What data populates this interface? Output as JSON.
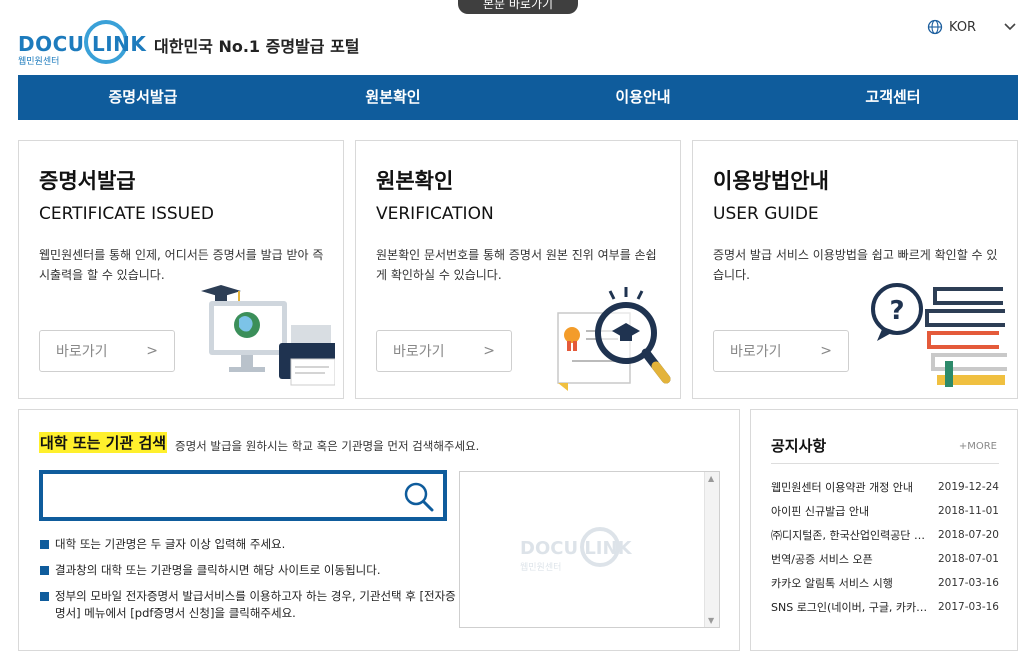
{
  "header": {
    "skip_link": "본문 바로가기",
    "logo_text": "DOCU LINK",
    "logo_sub": "웹민원센터",
    "tagline": "대한민국 No.1 증명발급 포털",
    "lang": "KOR"
  },
  "nav": [
    "증명서발급",
    "원본확인",
    "이용안내",
    "고객센터"
  ],
  "cards": [
    {
      "title": "증명서발급",
      "subtitle": "CERTIFICATE ISSUED",
      "desc": "웹민원센터를 통해 인제, 어디서든 증명서를 발급 받아 즉시출력을 할 수 있습니다.",
      "button": "바로가기",
      "arrow": ">",
      "icon": "computer-printer-icon"
    },
    {
      "title": "원본확인",
      "subtitle": "VERIFICATION",
      "desc": "원본확인 문서번호를 통해 증명서 원본 진위 여부를 손쉽게 확인하실 수 있습니다.",
      "button": "바로가기",
      "arrow": ">",
      "icon": "certificate-magnifier-icon"
    },
    {
      "title": "이용방법안내",
      "subtitle": "USER GUIDE",
      "desc": "증명서 발급 서비스 이용방법을 쉽고 빠르게 확인할 수 있습니다.",
      "button": "바로가기",
      "arrow": ">",
      "icon": "question-books-icon"
    }
  ],
  "search": {
    "title": "대학 또는 기관 검색",
    "desc": "증명서 발급을 원하시는 학교 혹은 기관명을 먼저 검색해주세요.",
    "value": "",
    "notes": [
      "대학 또는 기관명은 두 글자 이상 입력해 주세요.",
      "결과창의 대학 또는 기관명을 클릭하시면 해당 사이트로 이동됩니다.",
      "정부의 모바일 전자증명서 발급서비스를 이용하고자 하는 경우, 기관선택 후 [전자증명서] 메뉴에서 [pdf증명서 신청]을 클릭해주세요."
    ],
    "watermark_text": "DOCU LINK",
    "watermark_sub": "웹민원센터"
  },
  "notice": {
    "title": "공지사항",
    "more": "+MORE",
    "items": [
      {
        "title": "웹민원센터 이용약관 개정 안내",
        "date": "2019-12-24"
      },
      {
        "title": "아이핀 신규발급 안내",
        "date": "2018-11-01"
      },
      {
        "title": "㈜디지털존, 한국산업인력공단 증명서 발급",
        "date": "2018-07-20"
      },
      {
        "title": "번역/공증 서비스 오픈",
        "date": "2018-07-01"
      },
      {
        "title": "카카오 알림톡 서비스 시행",
        "date": "2017-03-16"
      },
      {
        "title": "SNS 로그인(네이버, 구글, 카카오)",
        "date": "2017-03-16"
      }
    ]
  },
  "colors": {
    "primary": "#0f5c9c",
    "logo": "#1d7bbd",
    "highlight": "#fff02c"
  }
}
